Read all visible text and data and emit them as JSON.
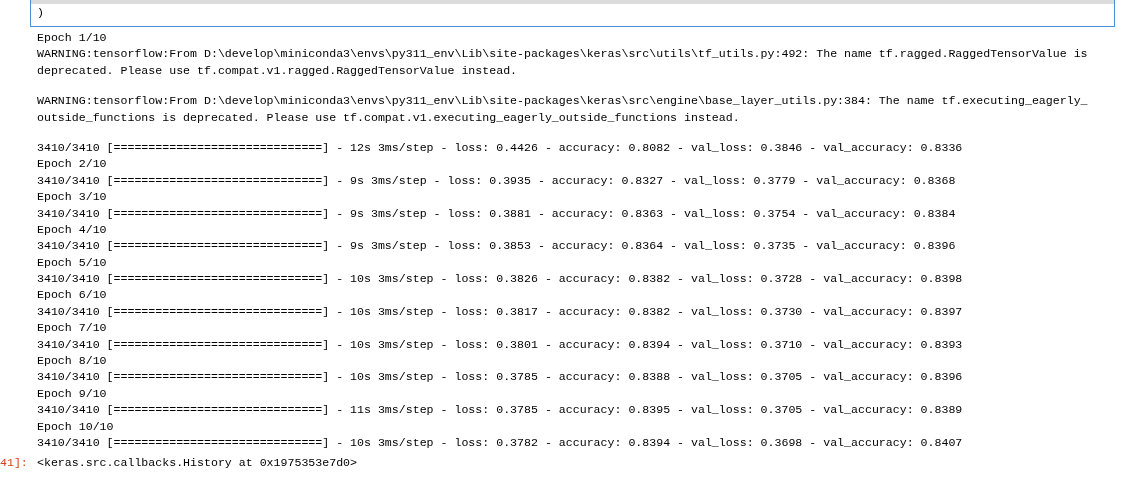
{
  "code_cell": {
    "lines": [
      ")"
    ]
  },
  "output": {
    "blocks": [
      {
        "lines": [
          "Epoch 1/10",
          "WARNING:tensorflow:From D:\\develop\\miniconda3\\envs\\py311_env\\Lib\\site-packages\\keras\\src\\utils\\tf_utils.py:492: The name tf.ragged.RaggedTensorValue is",
          "deprecated. Please use tf.compat.v1.ragged.RaggedTensorValue instead."
        ]
      },
      {
        "lines": [
          "WARNING:tensorflow:From D:\\develop\\miniconda3\\envs\\py311_env\\Lib\\site-packages\\keras\\src\\engine\\base_layer_utils.py:384: The name tf.executing_eagerly_",
          "outside_functions is deprecated. Please use tf.compat.v1.executing_eagerly_outside_functions instead."
        ]
      },
      {
        "lines": [
          "3410/3410 [==============================] - 12s 3ms/step - loss: 0.4426 - accuracy: 0.8082 - val_loss: 0.3846 - val_accuracy: 0.8336",
          "Epoch 2/10",
          "3410/3410 [==============================] - 9s 3ms/step - loss: 0.3935 - accuracy: 0.8327 - val_loss: 0.3779 - val_accuracy: 0.8368",
          "Epoch 3/10",
          "3410/3410 [==============================] - 9s 3ms/step - loss: 0.3881 - accuracy: 0.8363 - val_loss: 0.3754 - val_accuracy: 0.8384",
          "Epoch 4/10",
          "3410/3410 [==============================] - 9s 3ms/step - loss: 0.3853 - accuracy: 0.8364 - val_loss: 0.3735 - val_accuracy: 0.8396",
          "Epoch 5/10",
          "3410/3410 [==============================] - 10s 3ms/step - loss: 0.3826 - accuracy: 0.8382 - val_loss: 0.3728 - val_accuracy: 0.8398",
          "Epoch 6/10",
          "3410/3410 [==============================] - 10s 3ms/step - loss: 0.3817 - accuracy: 0.8382 - val_loss: 0.3730 - val_accuracy: 0.8397",
          "Epoch 7/10",
          "3410/3410 [==============================] - 10s 3ms/step - loss: 0.3801 - accuracy: 0.8394 - val_loss: 0.3710 - val_accuracy: 0.8393",
          "Epoch 8/10",
          "3410/3410 [==============================] - 10s 3ms/step - loss: 0.3785 - accuracy: 0.8388 - val_loss: 0.3705 - val_accuracy: 0.8396",
          "Epoch 9/10",
          "3410/3410 [==============================] - 11s 3ms/step - loss: 0.3785 - accuracy: 0.8395 - val_loss: 0.3705 - val_accuracy: 0.8389",
          "Epoch 10/10",
          "3410/3410 [==============================] - 10s 3ms/step - loss: 0.3782 - accuracy: 0.8394 - val_loss: 0.3698 - val_accuracy: 0.8407"
        ]
      }
    ]
  },
  "result": {
    "prompt": "41]:",
    "text": "<keras.src.callbacks.History at 0x1975353e7d0>"
  }
}
